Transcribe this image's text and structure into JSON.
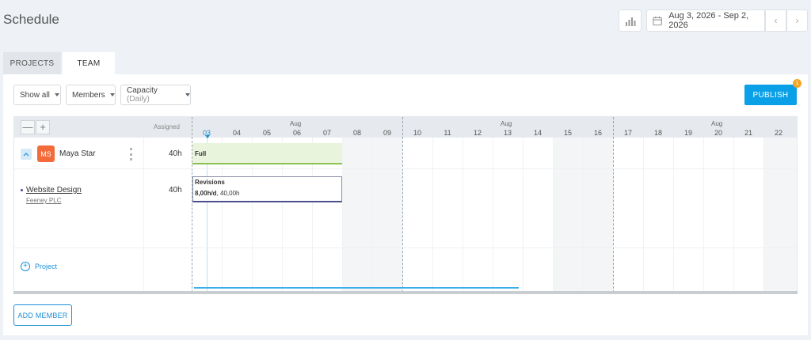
{
  "page": {
    "title": "Schedule"
  },
  "header": {
    "date_range": "Aug 3, 2026 - Sep 2, 2026",
    "prev": "‹",
    "next": "›"
  },
  "tabs": [
    {
      "label": "PROJECTS",
      "active": false
    },
    {
      "label": "TEAM",
      "active": true
    }
  ],
  "filters": {
    "show": "Show all",
    "group": "Members",
    "capacity_label": "Capacity",
    "capacity_unit": "(Daily)"
  },
  "publish": {
    "label": "PUBLISH",
    "badge": "1"
  },
  "grid": {
    "ctrl_minus": "—",
    "ctrl_plus": "+",
    "assigned_header": "Assigned",
    "months": [
      "Aug",
      "Aug",
      "Aug"
    ],
    "weeks": [
      [
        "03",
        "04",
        "05",
        "06",
        "07",
        "08",
        "09"
      ],
      [
        "10",
        "11",
        "12",
        "13",
        "14",
        "15",
        "16"
      ],
      [
        "17",
        "18",
        "19",
        "20",
        "21",
        "22"
      ]
    ],
    "today": "03"
  },
  "member": {
    "initials": "MS",
    "name": "Maya Star",
    "hours": "40h",
    "capacity_bar_label": "Full"
  },
  "project": {
    "name": "Website Design",
    "client": "Feeney PLC",
    "hours": "40h",
    "task_title": "Revisions",
    "task_rate": "8,00h/d",
    "task_total": ", 40,00h"
  },
  "add_project_label": "Project",
  "add_member_label": "ADD MEMBER",
  "colors": {
    "accent": "#0aa0e8",
    "avatar": "#f26b3a",
    "capacity_full": "#8cc152",
    "task_border": "#4b4f8f",
    "badge": "#f5a623"
  }
}
